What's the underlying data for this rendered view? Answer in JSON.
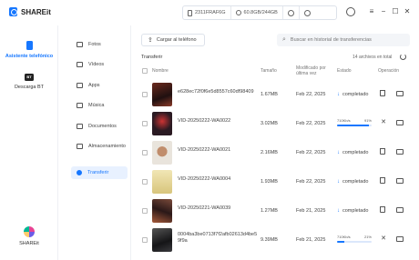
{
  "app": {
    "name": "SHAREit"
  },
  "device_bar": {
    "device_id": "2311FRAF6G",
    "storage": "60.8GB/244GB"
  },
  "rail": {
    "items": [
      {
        "label": "Asistente telefónico",
        "active": true
      },
      {
        "label": "Descarga BT",
        "active": false
      }
    ],
    "bottom_label": "SHAREit"
  },
  "sidebar": {
    "items": [
      {
        "label": "Fotos"
      },
      {
        "label": "Vídeos"
      },
      {
        "label": "Apps"
      },
      {
        "label": "Música"
      },
      {
        "label": "Documentos"
      },
      {
        "label": "Almacenamiento"
      },
      {
        "label": "Transferir",
        "active": true
      }
    ]
  },
  "toolbar": {
    "upload_label": "Cargar al teléfono",
    "search_placeholder": "Buscar en historial de transferencias"
  },
  "section": {
    "title": "Transferir",
    "total": "14 archivos en total"
  },
  "table": {
    "headers": {
      "name": "Nombre",
      "size": "Tamaño",
      "modified": "Modificado por última vez",
      "status": "Estado",
      "operation": "Operación"
    },
    "rows": [
      {
        "name": "e628ec72f0f6e5d8557c60df98409",
        "size": "1.67MB",
        "date": "Feb 22, 2025",
        "status": "completado",
        "thumb": "#3a1c1c"
      },
      {
        "name": "VID-20250222-WA0022",
        "size": "3.02MB",
        "date": "Feb 22, 2025",
        "progress_speed": "710Kb/s",
        "progress_pct": "91%",
        "progress": 0.91,
        "thumb": "#2a1a22"
      },
      {
        "name": "VID-20250222-WA0021",
        "size": "2.16MB",
        "date": "Feb 22, 2025",
        "status": "completado",
        "thumb": "#c9b79f"
      },
      {
        "name": "VID-20250222-WA0004",
        "size": "1.93MB",
        "date": "Feb 22, 2025",
        "status": "completado",
        "thumb": "#e5d59a"
      },
      {
        "name": "VID-20250221-WA0039",
        "size": "1.27MB",
        "date": "Feb 21, 2025",
        "status": "completado",
        "thumb": "#4a2a2a"
      },
      {
        "name": "0004ba3be0713f7f2afb02613d4be59f9a",
        "size": "9.39MB",
        "date": "Feb 21, 2025",
        "progress_speed": "710Kb/s",
        "progress_pct": "21%",
        "progress": 0.21,
        "thumb": "#262628"
      }
    ]
  }
}
